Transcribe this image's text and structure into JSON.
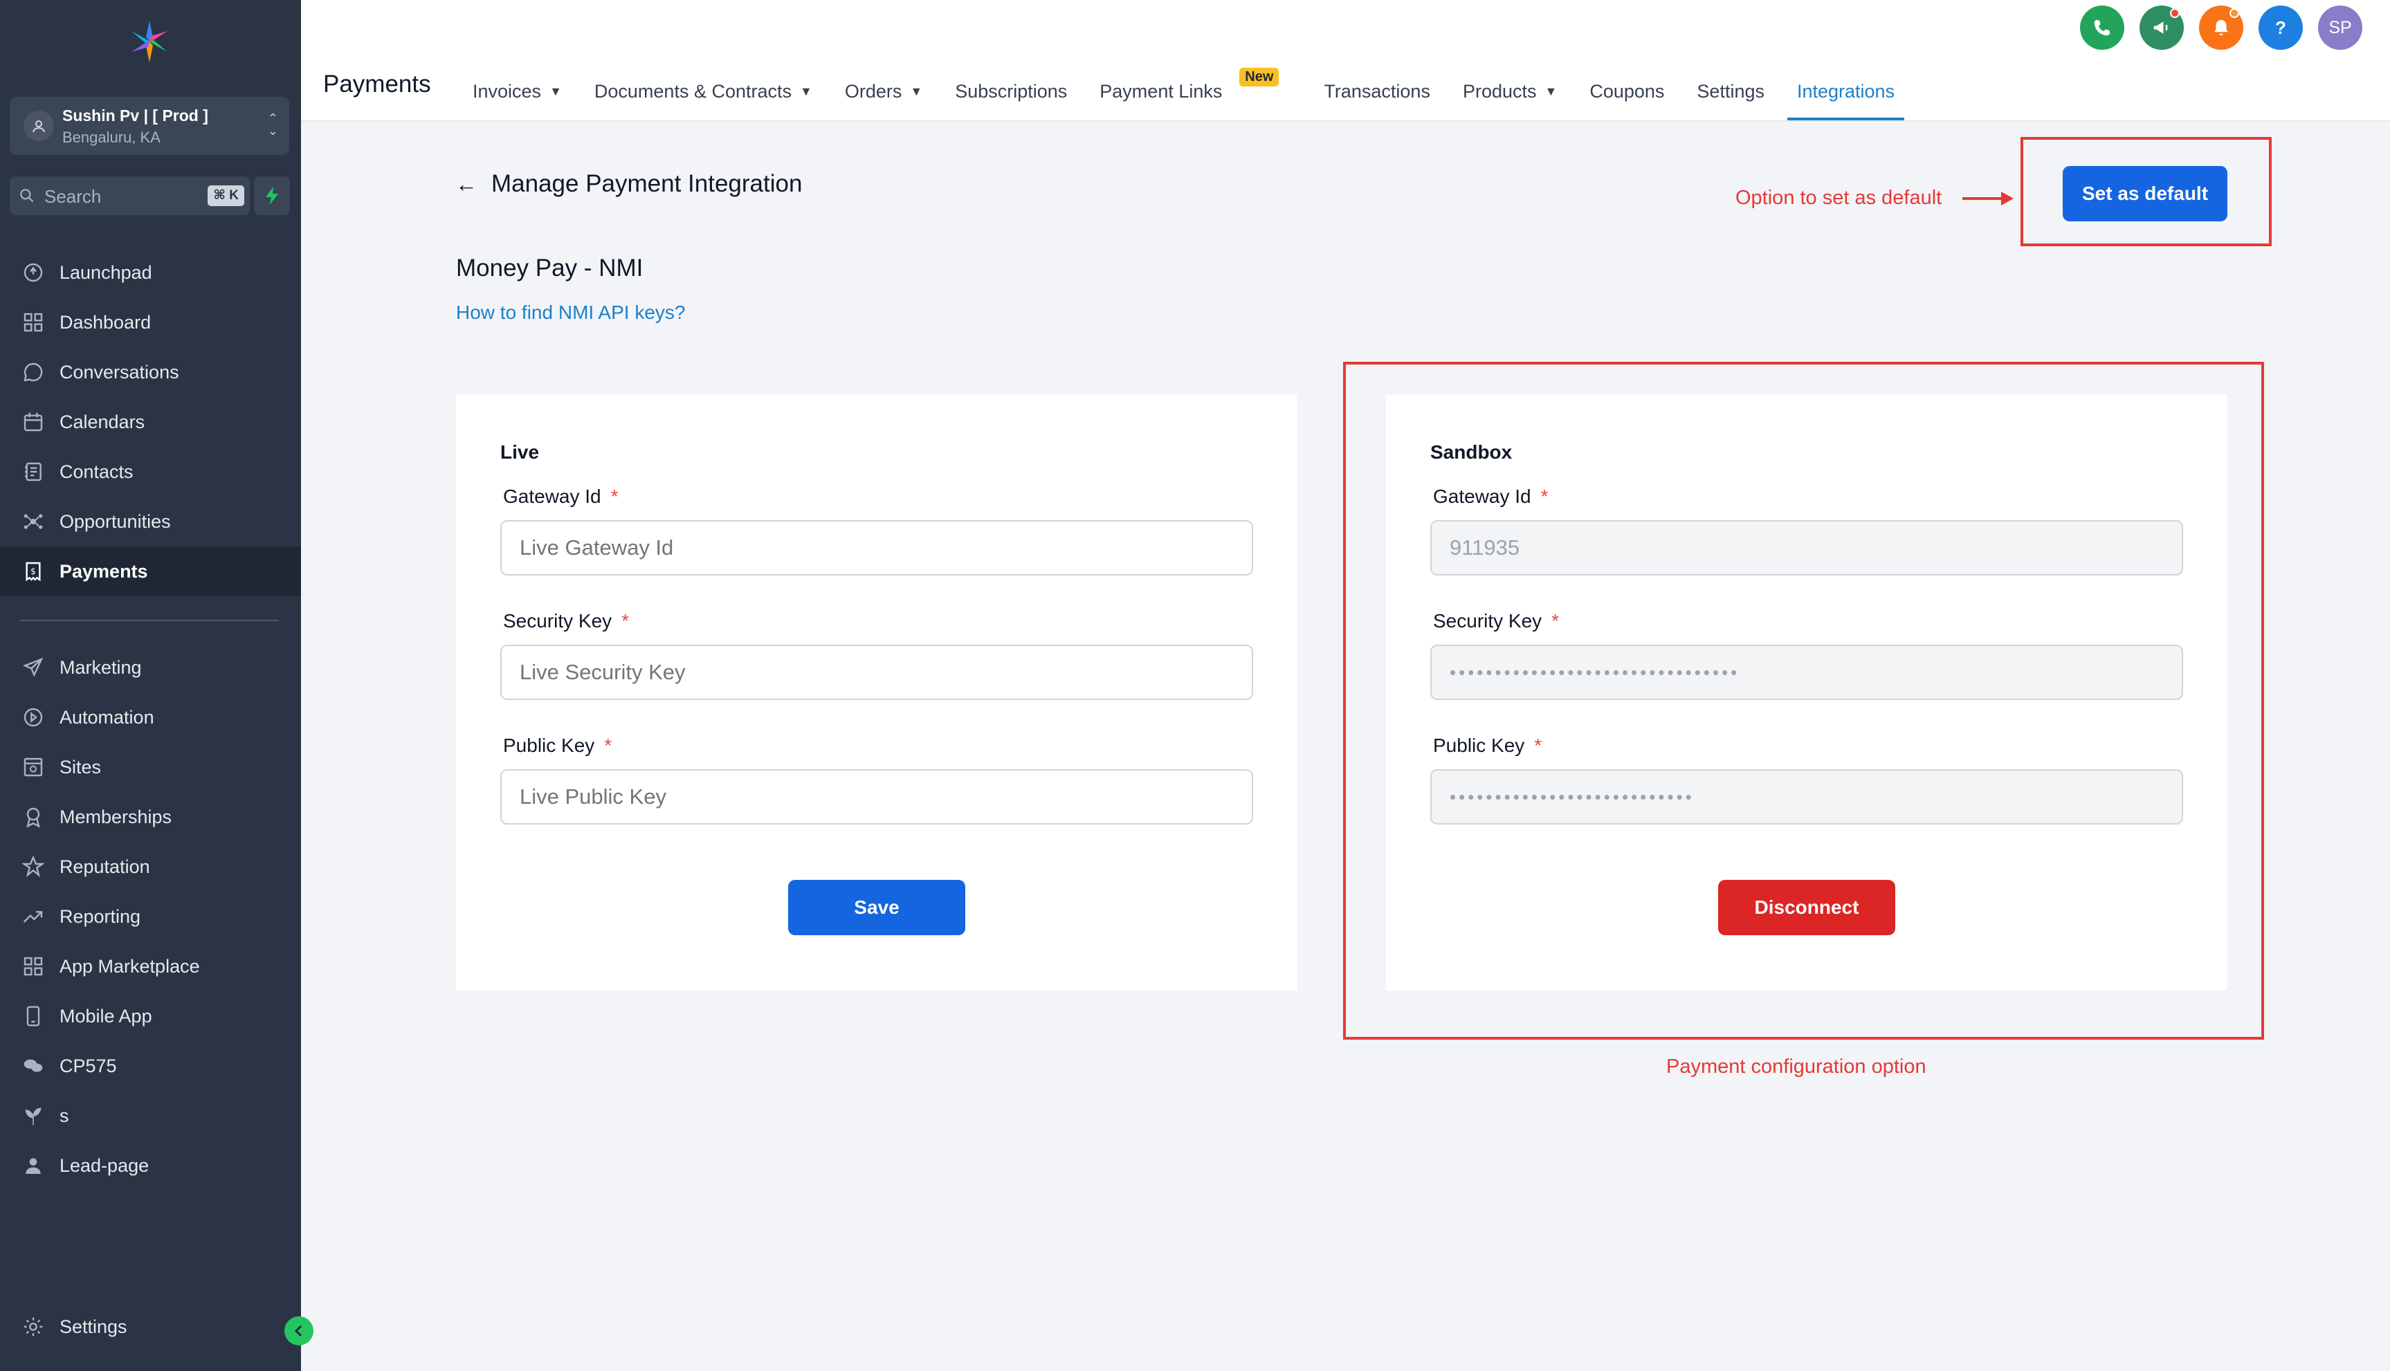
{
  "sidebar": {
    "account": {
      "name": "Sushin Pv | [ Prod ]",
      "location": "Bengaluru, KA"
    },
    "search": {
      "placeholder": "Search",
      "shortcut": "⌘ K"
    },
    "items": [
      {
        "label": "Launchpad",
        "icon": "launchpad-icon"
      },
      {
        "label": "Dashboard",
        "icon": "dashboard-icon"
      },
      {
        "label": "Conversations",
        "icon": "chat-bubble-icon"
      },
      {
        "label": "Calendars",
        "icon": "calendar-icon"
      },
      {
        "label": "Contacts",
        "icon": "contacts-icon"
      },
      {
        "label": "Opportunities",
        "icon": "opportunities-icon"
      },
      {
        "label": "Payments",
        "icon": "payments-icon",
        "active": true
      }
    ],
    "items2": [
      {
        "label": "Marketing",
        "icon": "send-icon"
      },
      {
        "label": "Automation",
        "icon": "automation-icon"
      },
      {
        "label": "Sites",
        "icon": "sites-icon"
      },
      {
        "label": "Memberships",
        "icon": "badge-icon"
      },
      {
        "label": "Reputation",
        "icon": "star-icon"
      },
      {
        "label": "Reporting",
        "icon": "trend-icon"
      },
      {
        "label": "App Marketplace",
        "icon": "grid-icon"
      },
      {
        "label": "Mobile App",
        "icon": "mobile-icon"
      },
      {
        "label": "CP575",
        "icon": "chat-icon"
      },
      {
        "label": "s",
        "icon": "plant-icon"
      },
      {
        "label": "Lead-page",
        "icon": "user-icon"
      }
    ],
    "settings_label": "Settings"
  },
  "topbar": {
    "title": "Payments",
    "user_initials": "SP",
    "tabs": [
      {
        "label": "Invoices",
        "dropdown": true
      },
      {
        "label": "Documents & Contracts",
        "dropdown": true
      },
      {
        "label": "Orders",
        "dropdown": true
      },
      {
        "label": "Subscriptions"
      },
      {
        "label": "Payment Links",
        "badge": "New"
      },
      {
        "label": "Transactions"
      },
      {
        "label": "Products",
        "dropdown": true
      },
      {
        "label": "Coupons"
      },
      {
        "label": "Settings"
      },
      {
        "label": "Integrations",
        "active": true
      }
    ]
  },
  "main": {
    "heading": "Manage Payment Integration",
    "provider": "Money Pay - NMI",
    "help_link": "How to find NMI API keys?",
    "set_default_label": "Set as default",
    "live": {
      "title": "Live",
      "gateway_label": "Gateway Id",
      "gateway_placeholder": "Live Gateway Id",
      "security_label": "Security Key",
      "security_placeholder": "Live Security Key",
      "public_label": "Public Key",
      "public_placeholder": "Live Public Key",
      "save_label": "Save"
    },
    "sandbox": {
      "title": "Sandbox",
      "gateway_label": "Gateway Id",
      "gateway_value": "911935",
      "security_label": "Security Key",
      "security_value": "••••••••••••••••••••••••••••••••",
      "public_label": "Public Key",
      "public_value": "•••••••••••••••••••••••••••",
      "disconnect_label": "Disconnect"
    },
    "required_mark": "*"
  },
  "annotations": {
    "default_note": "Option to set as default",
    "config_note": "Payment configuration option"
  },
  "colors": {
    "primary": "#1565e0",
    "danger": "#dc2626",
    "annotation": "#e53935",
    "sidebar_bg": "#2a3444",
    "active_tab": "#1d80c9"
  }
}
